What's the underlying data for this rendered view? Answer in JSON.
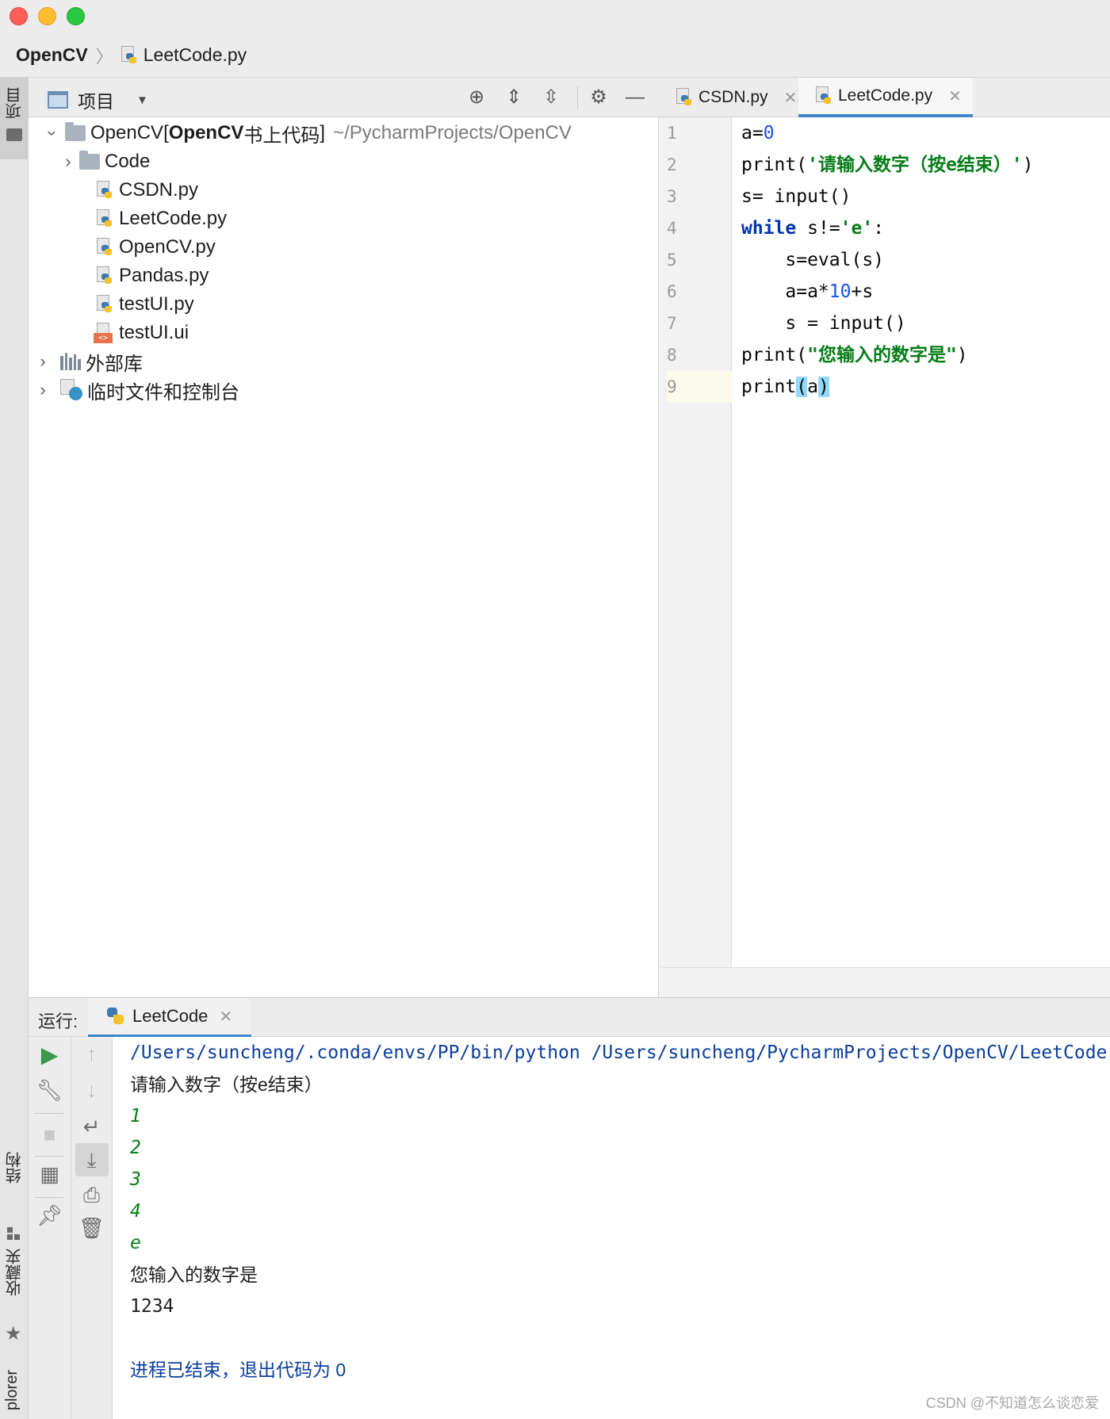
{
  "breadcrumb": {
    "project": "OpenCV",
    "file": "LeetCode.py"
  },
  "left_strip": {
    "project_tab": "项目",
    "structure_tab": "结构",
    "favorites_tab": "收藏夹",
    "explorer_tab": "plorer"
  },
  "project_panel": {
    "title": "项目",
    "root": {
      "name": "OpenCV",
      "bracket_open": " [",
      "module_name": "OpenCV",
      "module_suffix": "书上代码",
      "bracket_close": "]",
      "path": "~/PycharmProjects/OpenCV"
    },
    "items": [
      {
        "label": "Code",
        "type": "folder"
      },
      {
        "label": "CSDN.py",
        "type": "python"
      },
      {
        "label": "LeetCode.py",
        "type": "python"
      },
      {
        "label": "OpenCV.py",
        "type": "python"
      },
      {
        "label": "Pandas.py",
        "type": "python"
      },
      {
        "label": "testUI.py",
        "type": "python"
      },
      {
        "label": "testUI.ui",
        "type": "ui"
      }
    ],
    "external_libraries": "外部库",
    "scratches": "临时文件和控制台"
  },
  "editor": {
    "tabs": [
      {
        "label": "CSDN.py",
        "active": false
      },
      {
        "label": "LeetCode.py",
        "active": true
      }
    ],
    "line_numbers": [
      "1",
      "2",
      "3",
      "4",
      "5",
      "6",
      "7",
      "8",
      "9"
    ],
    "code": {
      "l1_a": "a=",
      "l1_b": "0",
      "l2_a": "print(",
      "l2_b": "'请输入数字（按e结束）'",
      "l2_c": ")",
      "l3": "s= input()",
      "l4_a": "while",
      "l4_b": " s!=",
      "l4_c": "'e'",
      "l4_d": ":",
      "l5": "    s=eval(s)",
      "l6_a": "    a=a*",
      "l6_b": "10",
      "l6_c": "+s",
      "l7": "    s = input()",
      "l8_a": "print(",
      "l8_b": "\"您输入的数字是\"",
      "l8_c": ")",
      "l9_a": "print",
      "l9_b": "(",
      "l9_c": "a",
      "l9_d": ")"
    }
  },
  "run_panel": {
    "label": "运行:",
    "tab": "LeetCode",
    "output": {
      "command": "/Users/suncheng/.conda/envs/PP/bin/python /Users/suncheng/PycharmProjects/OpenCV/LeetCode.py",
      "prompt": "请输入数字（按e结束）",
      "inputs": [
        "1",
        "2",
        "3",
        "4",
        "e"
      ],
      "result_label": "您输入的数字是",
      "result": "1234",
      "exit": "进程已结束，退出代码为 0"
    }
  },
  "watermark": "CSDN @不知道怎么谈恋爱",
  "colors": {
    "accent": "#4083c9",
    "keyword": "#0033b3",
    "string": "#067d17",
    "number": "#1750eb",
    "console_path": "#0b3e9c"
  }
}
